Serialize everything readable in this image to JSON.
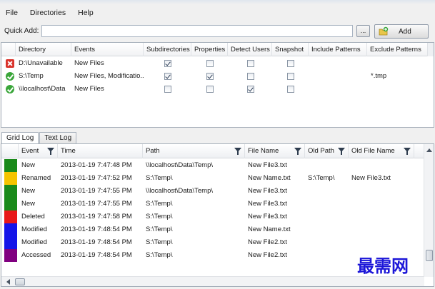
{
  "menu": [
    "File",
    "Directories",
    "Help"
  ],
  "quick_add": {
    "label": "Quick Add:",
    "value": "",
    "browse_label": "...",
    "add_label": "Add"
  },
  "dir_table": {
    "columns": [
      "Directory",
      "Events",
      "Subdirectories",
      "Properties",
      "Detect Users",
      "Snapshot",
      "Include Patterns",
      "Exclude Patterns"
    ],
    "rows": [
      {
        "status": "error",
        "directory": "D:\\Unavailable",
        "events": "New Files",
        "subdirectories": true,
        "properties": false,
        "detect_users": false,
        "snapshot": false,
        "include": "",
        "exclude": ""
      },
      {
        "status": "ok",
        "directory": "S:\\Temp",
        "events": "New Files, Modificatio...",
        "subdirectories": true,
        "properties": true,
        "detect_users": false,
        "snapshot": false,
        "include": "",
        "exclude": "*.tmp"
      },
      {
        "status": "ok",
        "directory": "\\\\localhost\\Data",
        "events": "New Files",
        "subdirectories": false,
        "properties": false,
        "detect_users": true,
        "snapshot": false,
        "include": "",
        "exclude": ""
      }
    ]
  },
  "tabs": [
    "Grid Log",
    "Text Log"
  ],
  "log_table": {
    "columns": [
      "Event",
      "Time",
      "Path",
      "File Name",
      "Old Path",
      "Old File Name"
    ],
    "rows": [
      {
        "color": "#1a8a1a",
        "event": "New",
        "time": "2013-01-19 7:47:48 PM",
        "path": "\\\\localhost\\Data\\Temp\\",
        "file": "New File3.txt",
        "old_path": "",
        "old_file": ""
      },
      {
        "color": "#f5c400",
        "event": "Renamed",
        "time": "2013-01-19 7:47:52 PM",
        "path": "S:\\Temp\\",
        "file": "New Name.txt",
        "old_path": "S:\\Temp\\",
        "old_file": "New File3.txt"
      },
      {
        "color": "#1a8a1a",
        "event": "New",
        "time": "2013-01-19 7:47:55 PM",
        "path": "\\\\localhost\\Data\\Temp\\",
        "file": "New File3.txt",
        "old_path": "",
        "old_file": ""
      },
      {
        "color": "#1a8a1a",
        "event": "New",
        "time": "2013-01-19 7:47:55 PM",
        "path": "S:\\Temp\\",
        "file": "New File3.txt",
        "old_path": "",
        "old_file": ""
      },
      {
        "color": "#e81818",
        "event": "Deleted",
        "time": "2013-01-19 7:47:58 PM",
        "path": "S:\\Temp\\",
        "file": "New File3.txt",
        "old_path": "",
        "old_file": ""
      },
      {
        "color": "#1414e8",
        "event": "Modified",
        "time": "2013-01-19 7:48:54 PM",
        "path": "S:\\Temp\\",
        "file": "New Name.txt",
        "old_path": "",
        "old_file": ""
      },
      {
        "color": "#1414e8",
        "event": "Modified",
        "time": "2013-01-19 7:48:54 PM",
        "path": "S:\\Temp\\",
        "file": "New File2.txt",
        "old_path": "",
        "old_file": ""
      },
      {
        "color": "#800080",
        "event": "Accessed",
        "time": "2013-01-19 7:48:54 PM",
        "path": "S:\\Temp\\",
        "file": "New File2.txt",
        "old_path": "",
        "old_file": ""
      }
    ]
  },
  "watermark": "最需网"
}
